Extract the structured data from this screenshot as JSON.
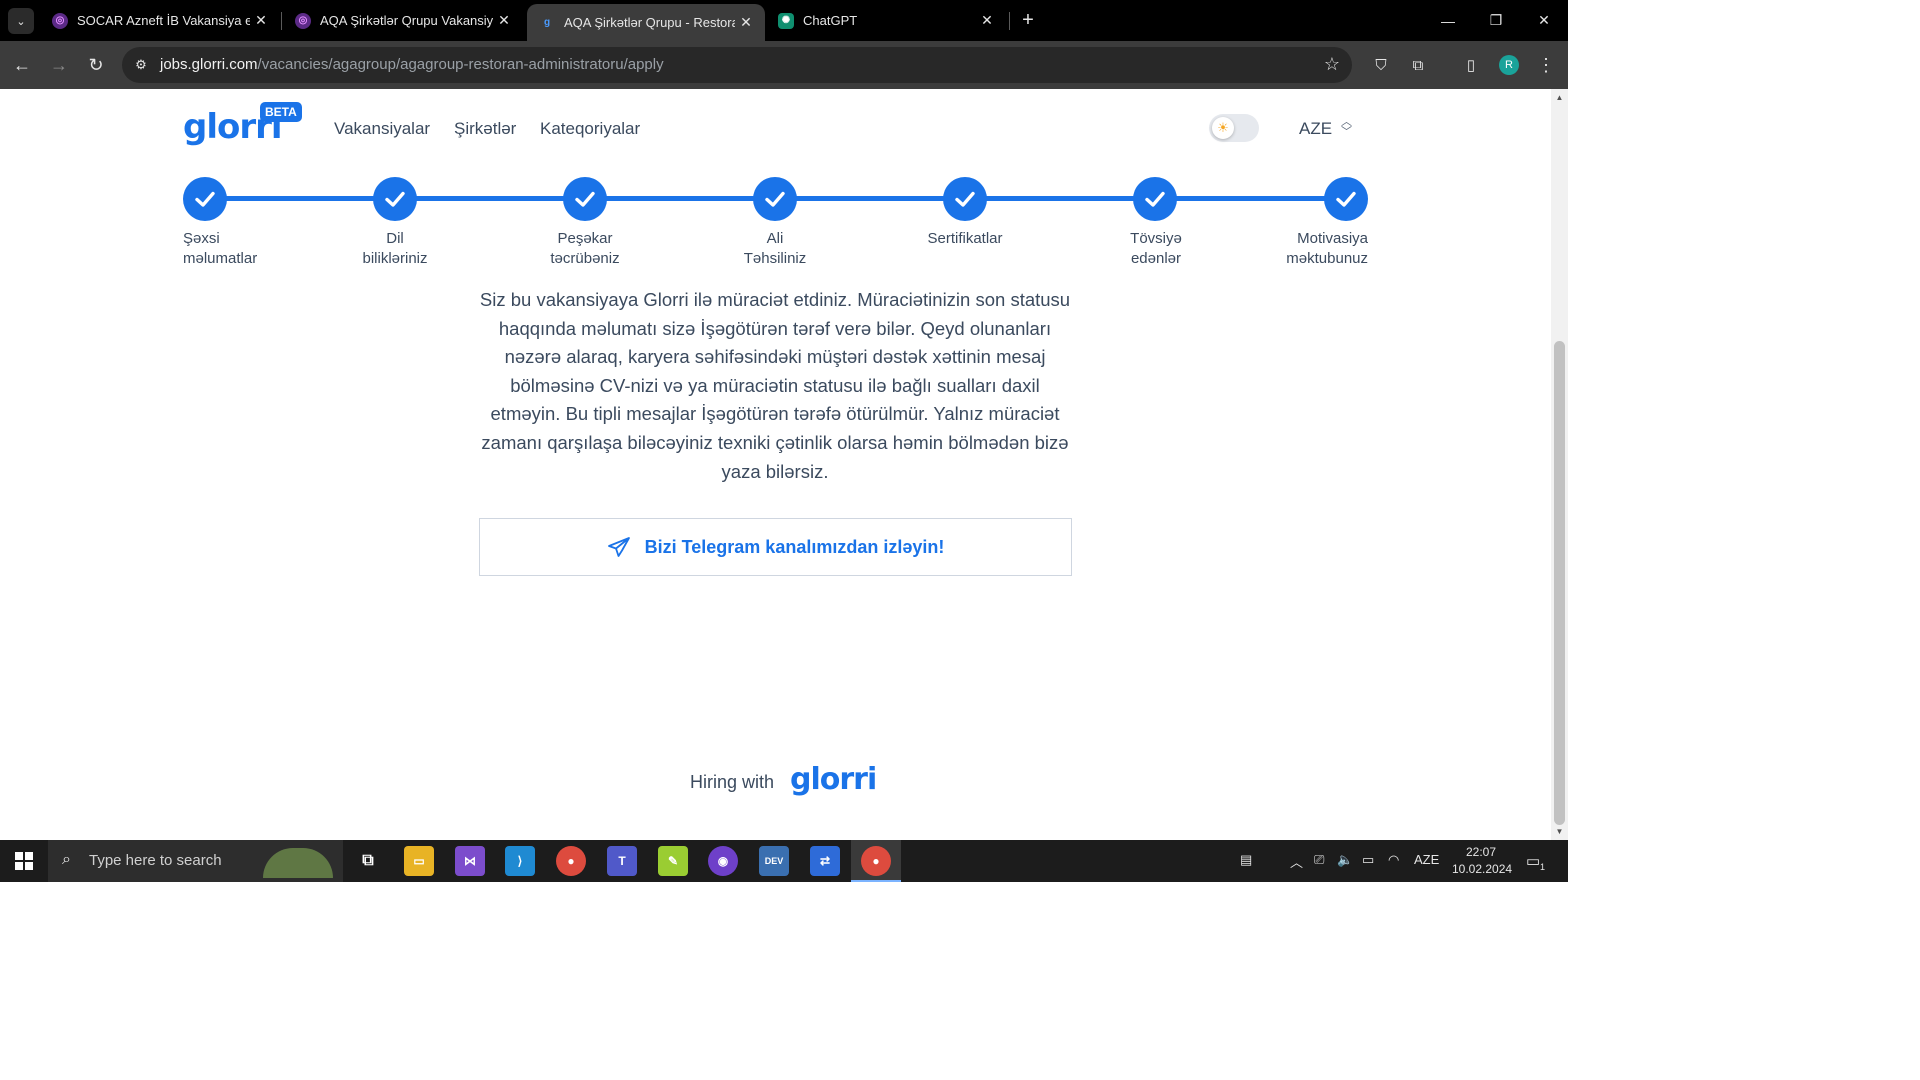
{
  "browser": {
    "tabs": [
      {
        "title": "SOCAR Azneft İB Vakansiya elan",
        "active": false
      },
      {
        "title": "AQA Şirkətlər Qrupu Vakansiya",
        "active": false
      },
      {
        "title": "AQA Şirkətlər Qrupu - Restoran",
        "active": true
      },
      {
        "title": "ChatGPT",
        "active": false
      }
    ],
    "url_host": "jobs.glorri.com",
    "url_path": "/vacancies/agagroup/agagroup-restoran-administratoru/apply",
    "profile_initial": "R"
  },
  "header": {
    "logo": "glorri",
    "beta_badge": "BETA",
    "nav": [
      "Vakansiyalar",
      "Şirkətlər",
      "Kateqoriyalar"
    ],
    "language": "AZE"
  },
  "steps": [
    {
      "line1": "Şəxsi",
      "line2": "məlumatlar",
      "done": true
    },
    {
      "line1": "Dil",
      "line2": "bilikləriniz",
      "done": true
    },
    {
      "line1": "Peşəkar",
      "line2": "təcrübəniz",
      "done": true
    },
    {
      "line1": "Ali",
      "line2": "Təhsiliniz",
      "done": true
    },
    {
      "line1": "Sertifikatlar",
      "line2": "",
      "done": true
    },
    {
      "line1": "Tövsiyə",
      "line2": "edənlər",
      "done": true
    },
    {
      "line1": "Motivasiya",
      "line2": "məktubunuz",
      "done": true
    }
  ],
  "message": "Siz bu vakansiyaya Glorri ilə müraciət etdiniz. Müraciətinizin son statusu haqqında məlumatı sizə İşəgötürən tərəf verə bilər. Qeyd olunanları nəzərə alaraq, karyera səhifəsindəki müştəri dəstək xəttinin mesaj bölməsinə CV-nizi və ya müraciətin statusu ilə bağlı sualları daxil etməyin. Bu tipli mesajlar İşəgötürən tərəfə ötürülmür. Yalnız müraciət zamanı qarşılaşa biləcəyiniz texniki çətinlik olarsa həmin bölmədən bizə yaza bilərsiz.",
  "telegram_button": "Bizi Telegram kanalımızdan izləyin!",
  "footer": {
    "hiring_text": "Hiring with",
    "logo": "glorri"
  },
  "taskbar": {
    "search_placeholder": "Type here to search",
    "language": "AZE",
    "time": "22:07",
    "date": "10.02.2024",
    "notification_count": "1"
  },
  "colors": {
    "brand": "#1a73e8",
    "text": "#3b4a5e"
  }
}
